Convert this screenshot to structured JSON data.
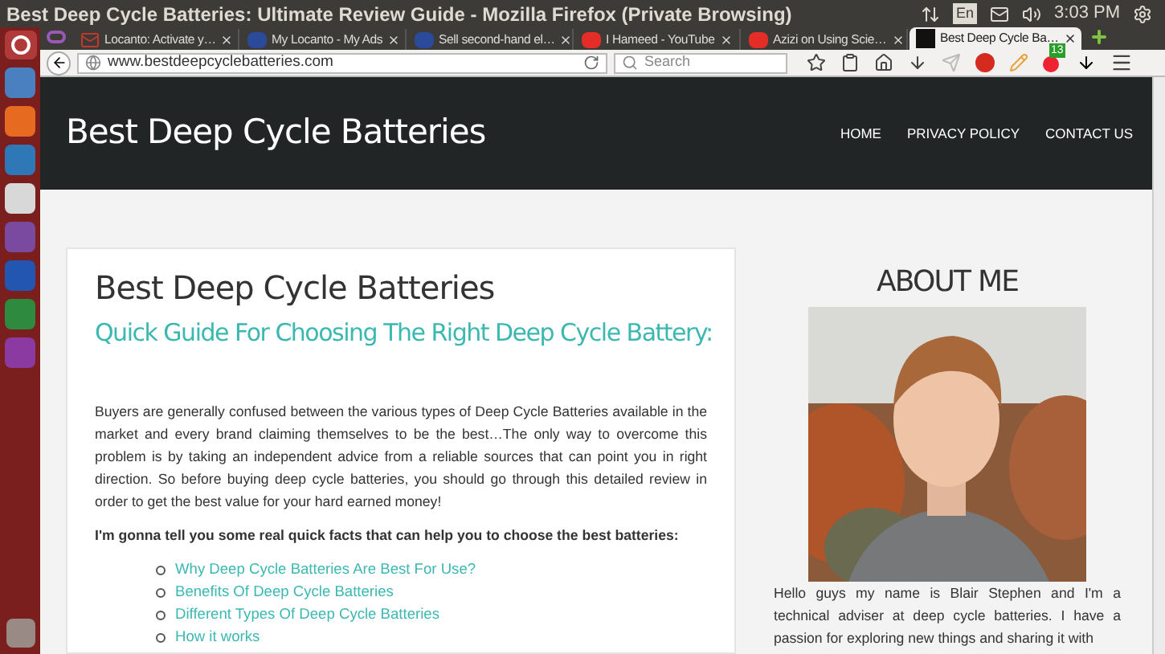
{
  "window": {
    "title": "Best Deep Cycle Batteries: Ultimate Review Guide - Mozilla Firefox (Private Browsing)"
  },
  "tray": {
    "keyboard": "En",
    "time": "3:03 PM"
  },
  "tabs": [
    {
      "label": "Locanto: Activate y…",
      "kind": "mail",
      "selected": false
    },
    {
      "label": "My Locanto - My Ads",
      "kind": "locanto",
      "selected": false
    },
    {
      "label": "Sell second-hand el…",
      "kind": "locanto",
      "selected": false
    },
    {
      "label": "I Hameed - YouTube",
      "kind": "youtube",
      "selected": false
    },
    {
      "label": "Azizi on Using Scie…",
      "kind": "youtube",
      "selected": false
    },
    {
      "label": "Best Deep Cycle Ba…",
      "kind": "site",
      "selected": true
    }
  ],
  "toolbar": {
    "url": "www.bestdeepcyclebatteries.com",
    "search_placeholder": "Search",
    "badge": "13"
  },
  "site": {
    "title": "Best Deep Cycle Batteries",
    "nav": [
      "HOME",
      "PRIVACY POLICY",
      "CONTACT US"
    ]
  },
  "article": {
    "title": "Best Deep Cycle Batteries",
    "subtitle": "Quick Guide For Choosing The Right Deep Cycle Battery:",
    "paragraph": "Buyers are generally confused between the various types of Deep Cycle Batteries available in the market and every brand claiming themselves to be the best…The only way to overcome this problem is by taking an independent advice from a reliable sources that can point you in right direction. So before buying deep cycle batteries, you should go through this detailed  review  in order to get the best value for your hard earned money!",
    "lead": "I'm gonna tell you some real quick facts that can help you to choose the best batteries:",
    "links": [
      "Why Deep Cycle Batteries Are Best For Use?",
      "Benefits Of Deep Cycle Batteries",
      "Different Types Of Deep Cycle Batteries",
      "How it works"
    ]
  },
  "sidebar": {
    "title": "ABOUT ME",
    "text": "Hello guys my name is Blair Stephen and I'm a technical adviser at deep cycle batteries. I have a passion for exploring new things and sharing it with"
  }
}
